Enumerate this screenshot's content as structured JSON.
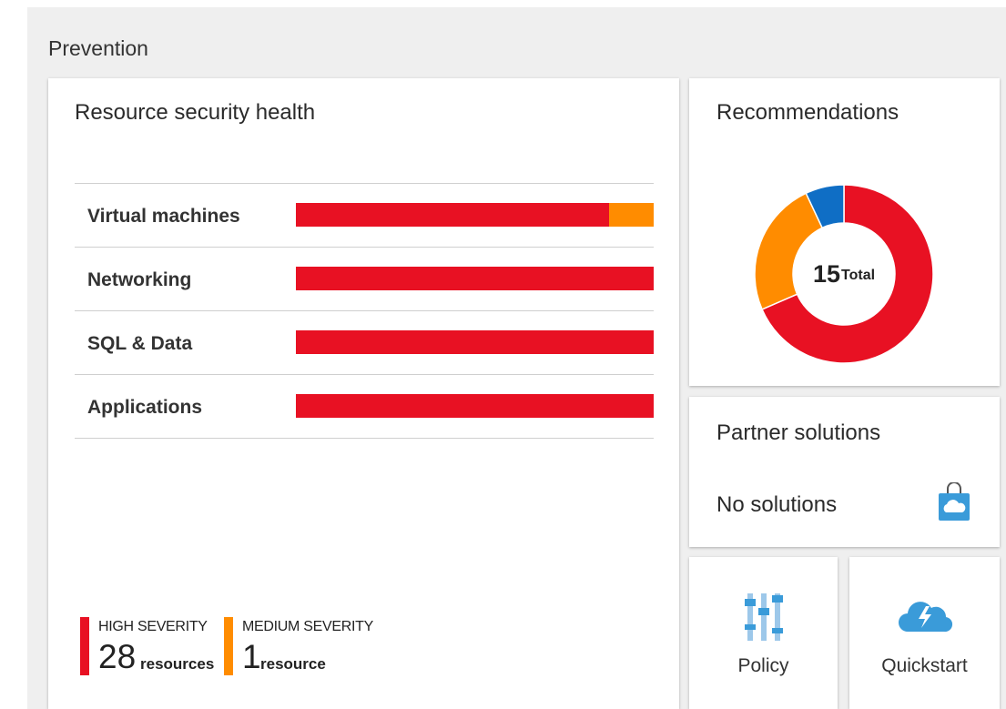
{
  "section": {
    "title": "Prevention"
  },
  "health": {
    "title": "Resource security health",
    "rows": [
      {
        "label": "Virtual machines",
        "high_fraction": 0.875,
        "medium_fraction": 0.125
      },
      {
        "label": "Networking",
        "high_fraction": 1.0,
        "medium_fraction": 0.0
      },
      {
        "label": "SQL & Data",
        "high_fraction": 1.0,
        "medium_fraction": 0.0
      },
      {
        "label": "Applications",
        "high_fraction": 1.0,
        "medium_fraction": 0.0
      }
    ],
    "legend": {
      "high": {
        "caption": "HIGH SEVERITY",
        "count": "28",
        "unit": "resources"
      },
      "medium": {
        "caption": "MEDIUM SEVERITY",
        "count": "1",
        "unit": "resource"
      }
    }
  },
  "recommendations": {
    "title": "Recommendations",
    "total_value": "15",
    "total_label": "Total",
    "slices": [
      {
        "color": "#e81123",
        "fraction": 0.685
      },
      {
        "color": "#ff8c00",
        "fraction": 0.245
      },
      {
        "color": "#0f6ec5",
        "fraction": 0.07
      }
    ]
  },
  "partner": {
    "title": "Partner solutions",
    "status": "No solutions",
    "icon": "shopping-bag-cloud-icon"
  },
  "policy": {
    "label": "Policy",
    "icon": "policy-sliders-icon"
  },
  "quickstart": {
    "label": "Quickstart",
    "icon": "cloud-lightning-icon"
  },
  "colors": {
    "high": "#e81123",
    "medium": "#ff8c00",
    "info": "#0f6ec5",
    "accent_icon": "#3a9bd9"
  }
}
